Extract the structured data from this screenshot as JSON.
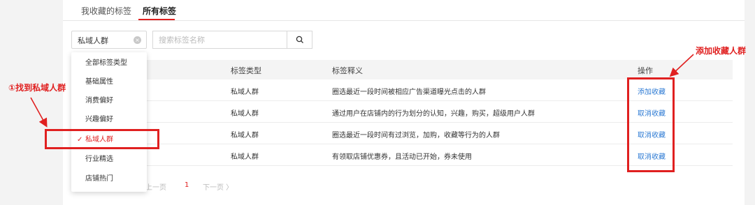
{
  "tabs": [
    {
      "label": "我收藏的标签"
    },
    {
      "label": "所有标签"
    }
  ],
  "filter": {
    "selected": "私域人群",
    "clear_icon": "close-circle-icon",
    "search_placeholder": "搜索标签名称",
    "search_icon": "search-icon"
  },
  "dropdown": {
    "options": [
      "全部标签类型",
      "基础属性",
      "消费偏好",
      "兴趣偏好",
      "私域人群",
      "行业精选",
      "店铺热门"
    ],
    "selected_index": 4,
    "check_icon": "check-icon"
  },
  "table": {
    "headers": [
      "标签类型",
      "标签释义",
      "操作"
    ],
    "rows": [
      {
        "type": "私域人群",
        "desc": "圈选最近一段时间被相应广告渠道曝光点击的人群",
        "action": "添加收藏"
      },
      {
        "type": "私域人群",
        "desc": "通过用户在店铺内的行为划分的认知，兴趣，购买，超级用户人群",
        "action": "取消收藏"
      },
      {
        "type": "私域人群",
        "desc": "圈选最近一段时间有过浏览，加购，收藏等行为的人群",
        "action": "取消收藏"
      },
      {
        "type": "私域人群",
        "desc": "有领取店铺优惠券，且活动已开始，券未使用",
        "action": "取消收藏"
      }
    ]
  },
  "pagination": {
    "prev": "上一页",
    "current": "1",
    "next": "下一页 〉"
  },
  "annotations": {
    "find_label": "①找到私域人群",
    "add_label": "添加收藏人群",
    "color": "#e02020"
  }
}
